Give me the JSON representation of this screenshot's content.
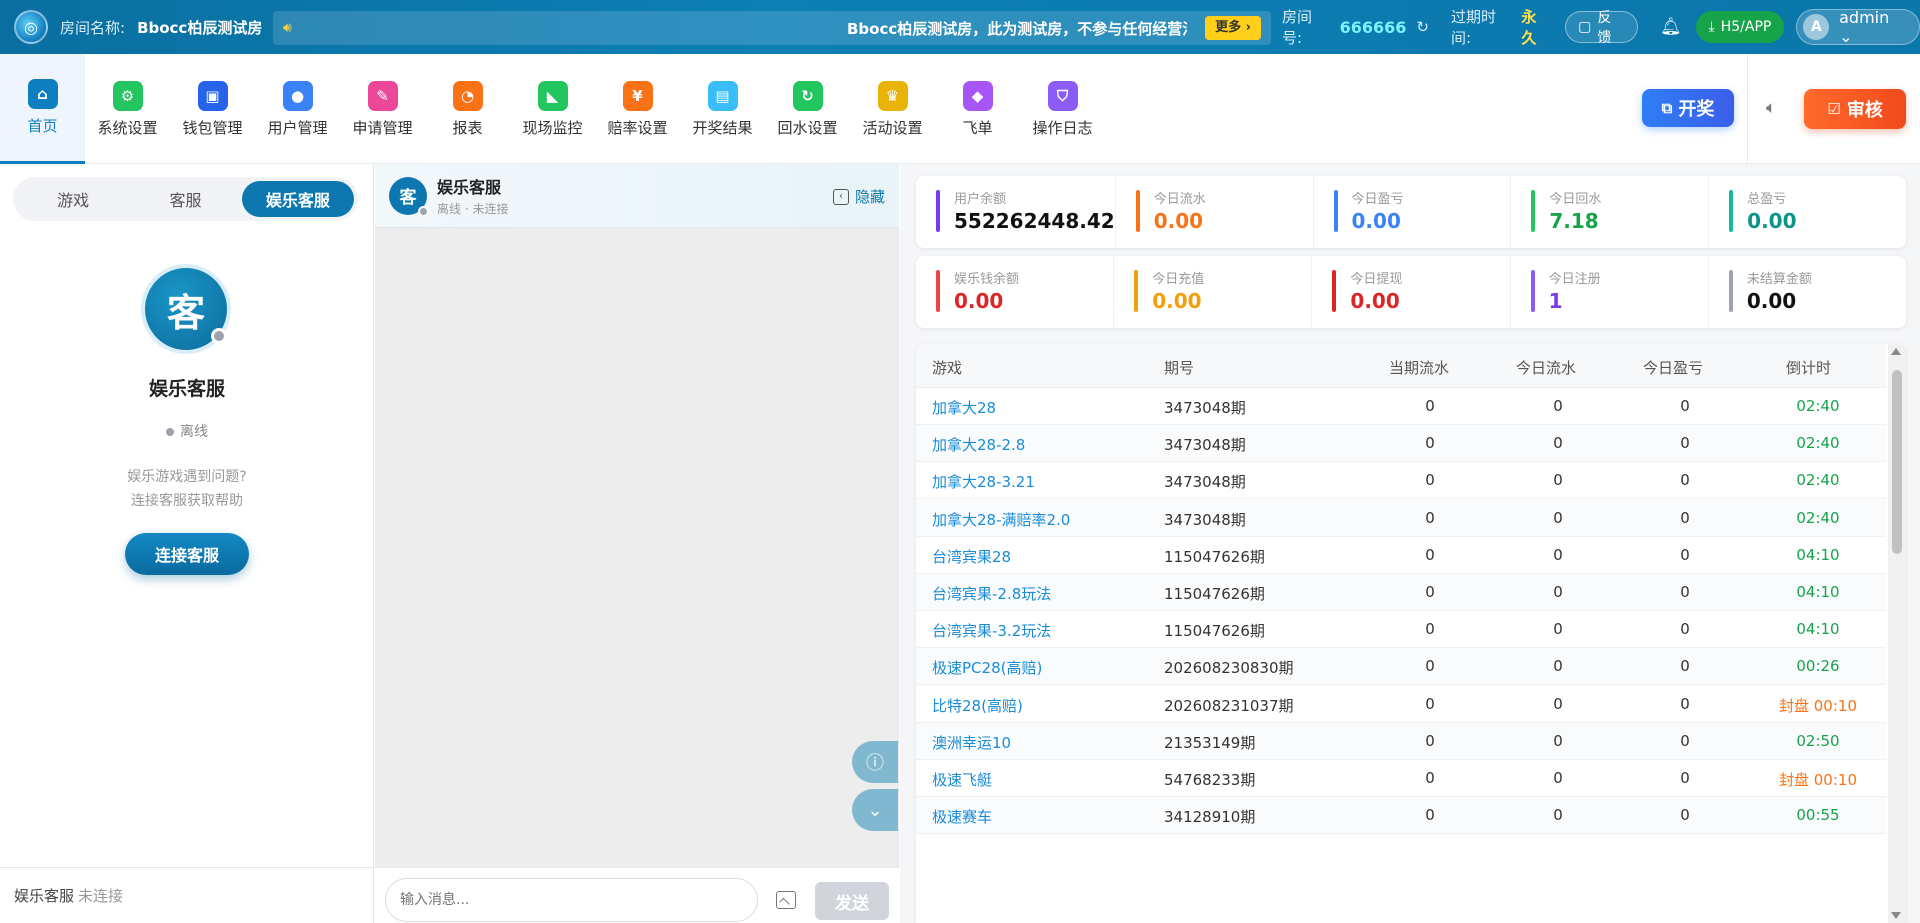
{
  "topbar": {
    "room_label": "房间名称:",
    "room_name": "Bbocc柏辰测试房",
    "marquee_text": "Bbocc柏辰测试房，此为测试房，不参与任何经营活动",
    "more_label": "更多 ›",
    "room_no_label": "房间号:",
    "room_no": "666666",
    "expire_label": "过期时间:",
    "expire_value": "永久",
    "feedback_label": "反馈",
    "h5_label": "H5/APP",
    "admin_initial": "A",
    "admin_name": "admin ⌄"
  },
  "nav": {
    "items": [
      {
        "label": "首页",
        "icon": "home-icon",
        "color": "#0d7fc0",
        "glyph": "⌂"
      },
      {
        "label": "系统设置",
        "icon": "gear-icon",
        "color": "#22c55e",
        "glyph": "⚙"
      },
      {
        "label": "钱包管理",
        "icon": "wallet-icon",
        "color": "#2563eb",
        "glyph": "▣"
      },
      {
        "label": "用户管理",
        "icon": "user-icon",
        "color": "#3b82f6",
        "glyph": "●"
      },
      {
        "label": "申请管理",
        "icon": "edit-icon",
        "color": "#ec4899",
        "glyph": "✎"
      },
      {
        "label": "报表",
        "icon": "pie-chart-icon",
        "color": "#f97316",
        "glyph": "◔"
      },
      {
        "label": "现场监控",
        "icon": "camera-icon",
        "color": "#22c55e",
        "glyph": "◣"
      },
      {
        "label": "赔率设置",
        "icon": "odds-icon",
        "color": "#f97316",
        "glyph": "¥"
      },
      {
        "label": "开奖结果",
        "icon": "result-icon",
        "color": "#38bdf8",
        "glyph": "▤"
      },
      {
        "label": "回水设置",
        "icon": "refresh-icon",
        "color": "#22c55e",
        "glyph": "↻"
      },
      {
        "label": "活动设置",
        "icon": "trophy-icon",
        "color": "#eab308",
        "glyph": "♛"
      },
      {
        "label": "飞单",
        "icon": "apps-icon",
        "color": "#a855f7",
        "glyph": "◆"
      },
      {
        "label": "操作日志",
        "icon": "shield-icon",
        "color": "#8b5cf6",
        "glyph": "⛉"
      }
    ],
    "draw_btn": "开奖",
    "audit_btn": "审核"
  },
  "left": {
    "tabs": [
      "游戏",
      "客服",
      "娱乐客服"
    ],
    "avatar_char": "客",
    "service_name": "娱乐客服",
    "status": "离线",
    "help_line1": "娱乐游戏遇到问题?",
    "help_line2": "连接客服获取帮助",
    "connect_btn": "连接客服",
    "footer_name": "娱乐客服",
    "footer_status": "未连接"
  },
  "chat": {
    "avatar_char": "客",
    "title": "娱乐客服",
    "subtitle": "离线 · 未连接",
    "hide_label": "隐藏",
    "input_placeholder": "输入消息...",
    "send_label": "发送"
  },
  "stats": {
    "row1": [
      {
        "label": "用户余额",
        "value": "552262448.42",
        "color": "#7c3aed",
        "valcolor": "#111111"
      },
      {
        "label": "今日流水",
        "value": "0.00",
        "color": "#f97316",
        "valcolor": "#f97316"
      },
      {
        "label": "今日盈亏",
        "value": "0.00",
        "color": "#3b82f6",
        "valcolor": "#3b82f6"
      },
      {
        "label": "今日回水",
        "value": "7.18",
        "color": "#22c55e",
        "valcolor": "#16a34a"
      },
      {
        "label": "总盈亏",
        "value": "0.00",
        "color": "#14b8a6",
        "valcolor": "#0d9488"
      }
    ],
    "row2": [
      {
        "label": "娱乐钱余额",
        "value": "0.00",
        "color": "#ef4444",
        "valcolor": "#dc2626"
      },
      {
        "label": "今日充值",
        "value": "0.00",
        "color": "#f59e0b",
        "valcolor": "#f59e0b"
      },
      {
        "label": "今日提现",
        "value": "0.00",
        "color": "#dc2626",
        "valcolor": "#dc2626"
      },
      {
        "label": "今日注册",
        "value": "1",
        "color": "#8b5cf6",
        "valcolor": "#7c3aed"
      },
      {
        "label": "未结算金额",
        "value": "0.00",
        "color": "#9ca3af",
        "valcolor": "#111111"
      }
    ]
  },
  "table": {
    "headers": [
      "游戏",
      "期号",
      "当期流水",
      "今日流水",
      "今日盈亏",
      "倒计时"
    ],
    "rows": [
      {
        "game": "加拿大28",
        "period": "3473048期",
        "cur": "0",
        "today": "0",
        "pnl": "0",
        "countdown": "02:40",
        "warn": false
      },
      {
        "game": "加拿大28-2.8",
        "period": "3473048期",
        "cur": "0",
        "today": "0",
        "pnl": "0",
        "countdown": "02:40",
        "warn": false
      },
      {
        "game": "加拿大28-3.21",
        "period": "3473048期",
        "cur": "0",
        "today": "0",
        "pnl": "0",
        "countdown": "02:40",
        "warn": false
      },
      {
        "game": "加拿大28-满赔率2.0",
        "period": "3473048期",
        "cur": "0",
        "today": "0",
        "pnl": "0",
        "countdown": "02:40",
        "warn": false
      },
      {
        "game": "台湾宾果28",
        "period": "115047626期",
        "cur": "0",
        "today": "0",
        "pnl": "0",
        "countdown": "04:10",
        "warn": false
      },
      {
        "game": "台湾宾果-2.8玩法",
        "period": "115047626期",
        "cur": "0",
        "today": "0",
        "pnl": "0",
        "countdown": "04:10",
        "warn": false
      },
      {
        "game": "台湾宾果-3.2玩法",
        "period": "115047626期",
        "cur": "0",
        "today": "0",
        "pnl": "0",
        "countdown": "04:10",
        "warn": false
      },
      {
        "game": "极速PC28(高赔)",
        "period": "202608230830期",
        "cur": "0",
        "today": "0",
        "pnl": "0",
        "countdown": "00:26",
        "warn": false
      },
      {
        "game": "比特28(高赔)",
        "period": "202608231037期",
        "cur": "0",
        "today": "0",
        "pnl": "0",
        "countdown": "封盘 00:10",
        "warn": true
      },
      {
        "game": "澳洲幸运10",
        "period": "21353149期",
        "cur": "0",
        "today": "0",
        "pnl": "0",
        "countdown": "02:50",
        "warn": false
      },
      {
        "game": "极速飞艇",
        "period": "54768233期",
        "cur": "0",
        "today": "0",
        "pnl": "0",
        "countdown": "封盘 00:10",
        "warn": true
      },
      {
        "game": "极速赛车",
        "period": "34128910期",
        "cur": "0",
        "today": "0",
        "pnl": "0",
        "countdown": "00:55",
        "warn": false
      }
    ]
  }
}
